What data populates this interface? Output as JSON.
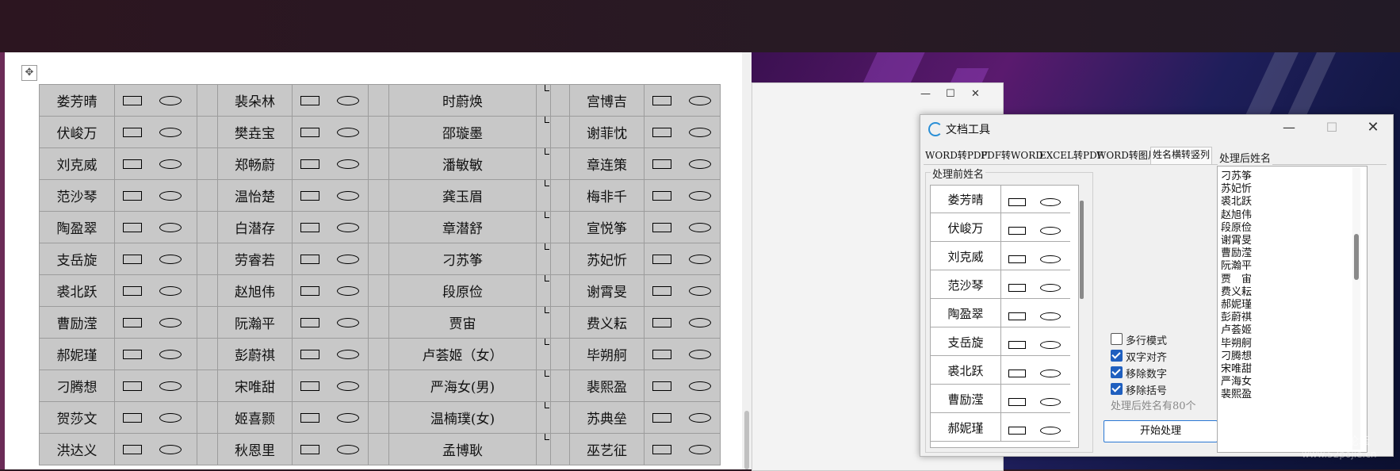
{
  "document": {
    "table_rows": [
      [
        "娄芳晴",
        "裴朵林",
        "时蔚焕",
        "宫博吉"
      ],
      [
        "伏峻万",
        "樊垚宝",
        "邵璇墨",
        "谢菲忱"
      ],
      [
        "刘克威",
        "郑畅蔚",
        "潘敏敏",
        "章连策"
      ],
      [
        "范沙琴",
        "温怡楚",
        "龚玉眉",
        "梅非千"
      ],
      [
        "陶盈翠",
        "白潜存",
        "章潜舒",
        "宣悦筝"
      ],
      [
        "支岳旋",
        "劳睿若",
        "刁苏筝",
        "苏妃忻"
      ],
      [
        "裘北跃",
        "赵旭伟",
        "段原俭",
        "谢霄旻"
      ],
      [
        "曹励滢",
        "阮瀚平",
        "贾宙",
        "费义耘"
      ],
      [
        "郝妮瑾",
        "彭蔚祺",
        "卢荟姬（女）",
        "毕朔舸"
      ],
      [
        "刁腾想",
        "宋唯甜",
        "严海女(男)",
        "裴熙盈"
      ],
      [
        "贺莎文",
        "姬喜颢",
        "温楠璞(女)",
        "苏典垒"
      ],
      [
        "洪达义",
        "秋恩里",
        "孟博耿",
        "巫艺征"
      ]
    ]
  },
  "background_window": {
    "minimize": "—",
    "maximize": "☐",
    "close": "✕"
  },
  "tool": {
    "title": "文档工具",
    "minimize": "—",
    "maximize": "☐",
    "close": "✕",
    "tabs": [
      "WORD转PDF",
      "PDF转WORD",
      "EXCEL转PDF",
      "WORD转图片",
      "姓名横转竖列"
    ],
    "active_tab": "姓名横转竖列",
    "before_group_title": "处理前姓名",
    "after_group_title": "处理后姓名",
    "before_names": [
      "娄芳晴",
      "伏峻万",
      "刘克威",
      "范沙琴",
      "陶盈翠",
      "支岳旋",
      "裘北跃",
      "曹励滢",
      "郝妮瑾"
    ],
    "options": [
      {
        "label": "多行模式",
        "checked": false
      },
      {
        "label": "双字对齐",
        "checked": true
      },
      {
        "label": "移除数字",
        "checked": true
      },
      {
        "label": "移除括号",
        "checked": true
      }
    ],
    "result_count": "处理后姓名有80个",
    "start_button": "开始处理",
    "after_names": [
      "刁苏筝",
      "苏妃忻",
      "裘北跃",
      "赵旭伟",
      "段原俭",
      "谢霄旻",
      "曹励滢",
      "阮瀚平",
      "贾　宙",
      "费义耘",
      "郝妮瑾",
      "彭蔚祺",
      "卢荟姬",
      "毕朔舸",
      "刁腾想",
      "宋唯甜",
      "严海女",
      "裴熙盈"
    ]
  },
  "watermark": {
    "line1": "吾爱破解论坛",
    "line2": "www.52pojie.cn"
  }
}
